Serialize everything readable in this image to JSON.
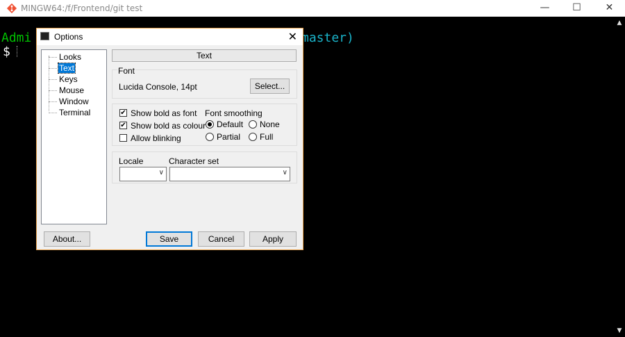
{
  "window": {
    "title": "MINGW64:/f/Frontend/git test",
    "minimize": "—",
    "maximize": "☐",
    "close": "✕"
  },
  "terminal": {
    "prompt_left": "Admi",
    "prompt_right": "master)",
    "prompt_symbol": "$",
    "prompt_color": "#00c000",
    "branch_color": "#1ab3c9"
  },
  "dialog": {
    "title": "Options",
    "close": "✕",
    "tree": {
      "items": [
        {
          "label": "Looks"
        },
        {
          "label": "Text",
          "selected": true
        },
        {
          "label": "Keys"
        },
        {
          "label": "Mouse"
        },
        {
          "label": "Window"
        },
        {
          "label": "Terminal"
        }
      ]
    },
    "section_header": "Text",
    "font": {
      "group_label": "Font",
      "value": "Lucida Console, 14pt",
      "select_button": "Select..."
    },
    "options": {
      "show_bold_as_font": {
        "label": "Show bold as font",
        "checked": true
      },
      "show_bold_as_colour": {
        "label": "Show bold as colour",
        "checked": true
      },
      "allow_blinking": {
        "label": "Allow blinking",
        "checked": false
      },
      "smoothing_label": "Font smoothing",
      "smoothing": {
        "default": {
          "label": "Default",
          "selected": true
        },
        "none": {
          "label": "None",
          "selected": false
        },
        "partial": {
          "label": "Partial",
          "selected": false
        },
        "full": {
          "label": "Full",
          "selected": false
        }
      }
    },
    "locale": {
      "locale_label": "Locale",
      "locale_value": "",
      "charset_label": "Character set",
      "charset_value": ""
    },
    "buttons": {
      "about": "About...",
      "save": "Save",
      "cancel": "Cancel",
      "apply": "Apply"
    },
    "accent_color": "#0078d7"
  }
}
